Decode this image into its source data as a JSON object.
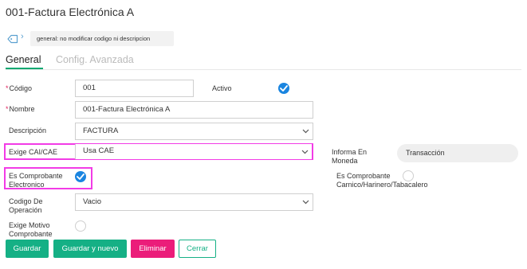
{
  "page": {
    "title": "001-Factura Electrónica A"
  },
  "tagbar": {
    "note": "general: no modificar codigo ni descripcion"
  },
  "tabs": [
    {
      "label": "General",
      "active": true
    },
    {
      "label": "Config. Avanzada",
      "active": false
    }
  ],
  "form": {
    "codigo": {
      "label": "Código",
      "value": "001",
      "required": true
    },
    "activo": {
      "label": "Activo",
      "checked": true
    },
    "nombre": {
      "label": "Nombre",
      "value": "001-Factura Electrónica A",
      "required": true
    },
    "descripcion": {
      "label": "Descripción",
      "value": "FACTURA"
    },
    "exige_cai": {
      "label": "Exige CAI/CAE",
      "value": "Usa CAE"
    },
    "informa_moneda": {
      "label": "Informa En Moneda",
      "value": "Transacción"
    },
    "es_comprobante_electronico": {
      "label": "Es Comprobante Electronico",
      "checked": true
    },
    "es_comprobante_carnico": {
      "label": "Es Comprobante Carnico/Harinero/Tabacalero",
      "checked": false
    },
    "codigo_operacion": {
      "label": "Codigo De Operación",
      "value": "Vacio"
    },
    "exige_motivo": {
      "label": "Exige Motivo Comprobante",
      "checked": false
    }
  },
  "buttons": {
    "guardar": "Guardar",
    "guardar_nuevo": "Guardar y nuevo",
    "eliminar": "Eliminar",
    "cerrar": "Cerrar"
  },
  "colors": {
    "accent_green": "#15b085",
    "danger_pink": "#eb1d7a",
    "check_blue": "#1a85e0",
    "highlight_magenta": "#f23be6"
  }
}
